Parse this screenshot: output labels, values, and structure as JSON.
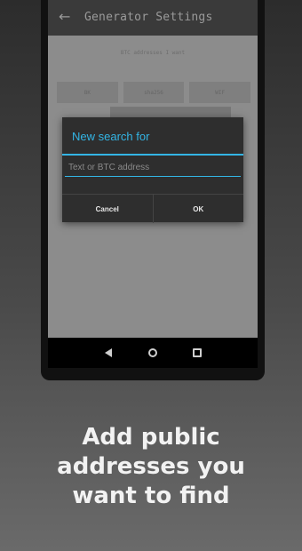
{
  "app": {
    "title": "Generator Settings",
    "subtitle": "BTC addresses I want",
    "coin_tabs": [
      "BK",
      "sha256",
      "WIF"
    ]
  },
  "dialog": {
    "title": "New search for",
    "input_placeholder": "Text or BTC address",
    "input_value": "",
    "cancel_label": "Cancel",
    "ok_label": "OK",
    "accent_color": "#33b5e5"
  },
  "icons": {
    "back": "arrow-left-icon",
    "nav_back": "triangle-back-icon",
    "nav_home": "circle-home-icon",
    "nav_recent": "square-recents-icon"
  },
  "caption": {
    "line1": "Add public",
    "line2": "addresses you",
    "line3": "want to find"
  }
}
